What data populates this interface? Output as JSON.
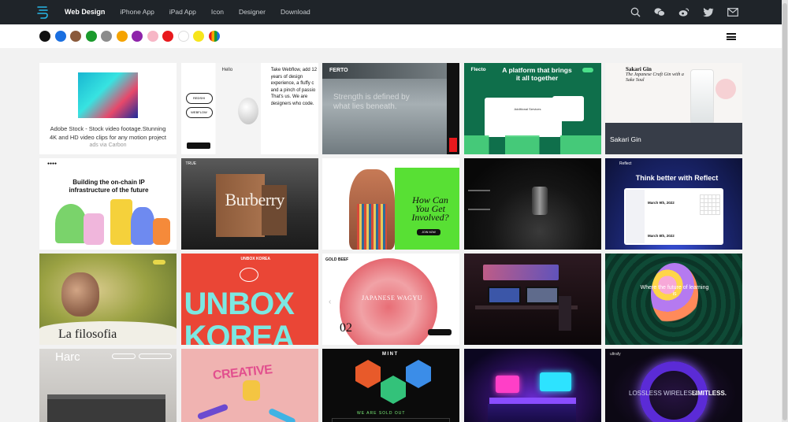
{
  "nav": {
    "items": [
      {
        "label": "Web Design",
        "active": true
      },
      {
        "label": "iPhone App",
        "active": false
      },
      {
        "label": "iPad App",
        "active": false
      },
      {
        "label": "Icon",
        "active": false
      },
      {
        "label": "Designer",
        "active": false
      },
      {
        "label": "Download",
        "active": false
      }
    ],
    "icons": [
      "search-icon",
      "wechat-icon",
      "weibo-icon",
      "twitter-icon",
      "mail-icon"
    ]
  },
  "colors": [
    "#111111",
    "#1a6fe0",
    "#8a5a3b",
    "#1a9a2c",
    "#8c8c8c",
    "#f5a300",
    "#8e24aa",
    "#f7b6c6",
    "#e8191d",
    "#ffffff",
    "#f7e51b",
    "multicolor"
  ],
  "ad": {
    "text": "Adobe Stock - Stock video footage.Stunning 4K and HD video clips for any motion project",
    "via": "ads via Carbon"
  },
  "cards": {
    "webflow": {
      "hello": "Hello",
      "text": "Take Webflow, add 12 years of design experience, a fluffy c and a pinch of passio That's us. We are designers who code.",
      "badge_top": "REDSHI",
      "badge_bottom": "WEBFLOW"
    },
    "ferro": {
      "brand": "FERTO",
      "text": "Strength is defined by what lies beneath."
    },
    "flecto": {
      "brand": "Flecto",
      "headline": "A platform that brings it all together",
      "section": "Additional Services"
    },
    "sakari": {
      "brand": "Sakari Gin",
      "tagline": "The Japanese Craft Gin with a Sake Soul",
      "caption": "Sakari Gin"
    },
    "ip": {
      "headline": "Building the on-chain IP infrastructure of the future"
    },
    "burberry": {
      "tag": "TRUE",
      "word": "Burberry"
    },
    "involved": {
      "headline": "How Can You Get Involved?",
      "button": "JOIN NOW"
    },
    "reflect": {
      "brand": "Reflect",
      "headline": "Think better with Reflect",
      "date1": "March 9th, 2022",
      "date2": "March 8th, 2022"
    },
    "filosofia": {
      "word": "La filosofia"
    },
    "unbox": {
      "brand": "UNBOX KOREA",
      "word1": "UNBOX",
      "word2": "KOREA"
    },
    "wagyu": {
      "title": "JAPANESE WAGYU",
      "number": "02"
    },
    "bloom": {
      "headline": "Where the future of learning is"
    },
    "harc": {
      "word": "Harc"
    },
    "creative": {
      "word": "CREATIVE"
    },
    "mint": {
      "brand": "MINT",
      "footer": "WE ARE SOLD OUT"
    },
    "lossless": {
      "brand": "ultrafy",
      "text1": "LOSSLESS WIRELESS.",
      "text2": "LIMITLESS."
    }
  }
}
